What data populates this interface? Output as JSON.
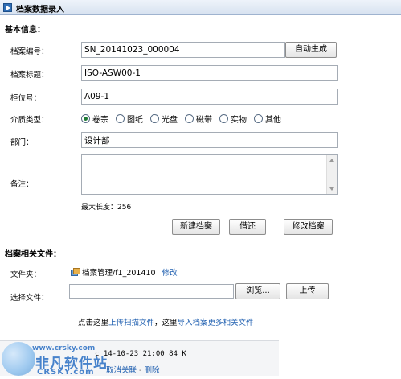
{
  "header": {
    "title": "档案数据录入"
  },
  "basic": {
    "heading": "基本信息：",
    "archive_no_label": "档案编号：",
    "archive_no_value": "SN_20141023_000004",
    "auto_gen_label": "自动生成",
    "title_label": "档案标题：",
    "title_value": "ISO-ASW00-1",
    "cabinet_label": "柜位号：",
    "cabinet_value": "A09-1",
    "media_label": "介质类型：",
    "media_options": [
      "卷宗",
      "图纸",
      "光盘",
      "磁带",
      "实物",
      "其他"
    ],
    "media_selected": "卷宗",
    "dept_label": "部门：",
    "dept_value": "设计部",
    "remark_label": "备注：",
    "remark_value": "",
    "maxlen_text": "最大长度：256",
    "buttons": {
      "new": "新建档案",
      "borrow": "借还",
      "modify": "修改档案"
    }
  },
  "files": {
    "heading": "档案相关文件：",
    "folder_label": "文件夹：",
    "folder_path": "档案管理/f1_201410",
    "folder_edit": "修改",
    "select_label": "选择文件：",
    "browse_label": "浏览...",
    "upload_label": "上传",
    "hint_prefix": "点击这里",
    "hint_link1": "上传扫描文件",
    "hint_mid": "，这里",
    "hint_link2": "导入档案更多相关文件",
    "file_meta": "c  14-10-23 21:00  84 K",
    "cancel_link": "取消关联",
    "delete_link": "删除"
  },
  "watermark": {
    "text1": "非凡软件站",
    "text2": "CRSKY.com",
    "text3": "www.crsky.com"
  },
  "colors": {
    "link": "#1f5fb0",
    "title_bar": "#d7e2f0",
    "radio_checked": "#1e7a34"
  }
}
